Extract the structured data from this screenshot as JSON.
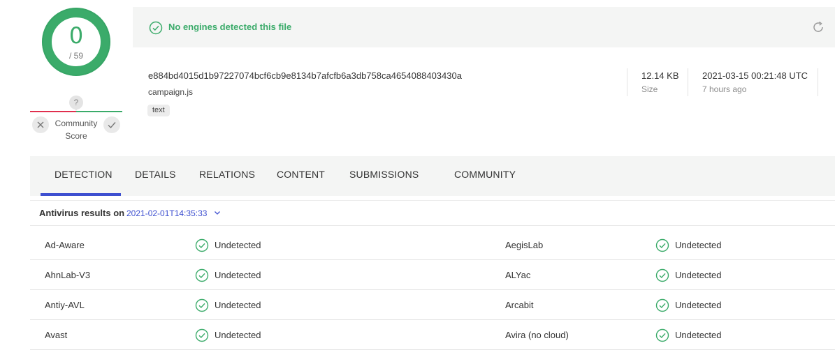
{
  "score": {
    "detections": "0",
    "total": "/ 59",
    "ring_color": "#3bab6a",
    "detection_ratio": 0
  },
  "community": {
    "question_icon": "question-icon",
    "question_glyph": "?",
    "label": "Community Score",
    "down_icon": "close-icon",
    "up_icon": "check-icon",
    "bad_color": "#e0304e",
    "good_color": "#3bab6a"
  },
  "banner": {
    "status_text": "No engines detected this file",
    "status_color": "#3bab6a",
    "check_icon": "check-circle-icon",
    "reload_icon": "reload-icon"
  },
  "file": {
    "hash": "e884bd4015d1b97227074bcf6cb9e8134b7afcfb6a3db758ca4654088403430a",
    "name": "campaign.js",
    "tag": "text",
    "size_value": "12.14 KB",
    "size_label": "Size",
    "date_value": "2021-03-15 00:21:48 UTC",
    "date_relative": "7 hours ago"
  },
  "tabs": [
    {
      "label": "DETECTION",
      "active": true
    },
    {
      "label": "DETAILS"
    },
    {
      "label": "RELATIONS"
    },
    {
      "label": "CONTENT"
    },
    {
      "label": "SUBMISSIONS"
    },
    {
      "label": "COMMUNITY"
    }
  ],
  "results": {
    "title": "Antivirus results on",
    "date": "2021-02-01T14:35:33",
    "chevron_icon": "chevron-down-icon",
    "accent_color": "#3d4fd0",
    "rows": [
      {
        "left_engine": "Ad-Aware",
        "left_result": "Undetected",
        "right_engine": "AegisLab",
        "right_result": "Undetected"
      },
      {
        "left_engine": "AhnLab-V3",
        "left_result": "Undetected",
        "right_engine": "ALYac",
        "right_result": "Undetected"
      },
      {
        "left_engine": "Antiy-AVL",
        "left_result": "Undetected",
        "right_engine": "Arcabit",
        "right_result": "Undetected"
      },
      {
        "left_engine": "Avast",
        "left_result": "Undetected",
        "right_engine": "Avira (no cloud)",
        "right_result": "Undetected"
      }
    ]
  }
}
